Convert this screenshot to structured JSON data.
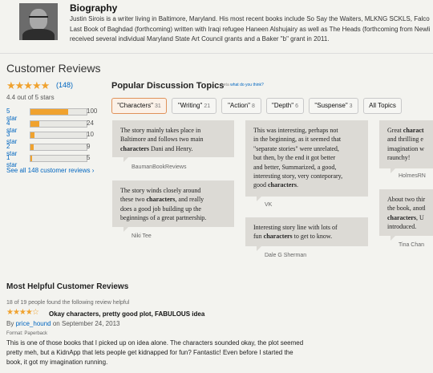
{
  "biography": {
    "title": "Biography",
    "lines": [
      "Justin Sirois is a writer living in Baltimore, Maryland. His most recent books include So Say the Waiters, MLKNG SCKLS, Falco",
      "Last Book of Baghdad (forthcoming) written with Iraqi refugee Haneen Alshujairy as well as The Heads (forthcoming from Newli",
      "received several individual Maryland State Art Council grants and a Baker \"b\" grant in 2011."
    ]
  },
  "summary": {
    "title": "Customer Reviews",
    "stars": "★★★★★",
    "count": "(148)",
    "out_of": "4.4 out of 5 stars",
    "rating": 4.4,
    "histogram": [
      {
        "label": "5 star",
        "count": "100",
        "fraction": 0.676
      },
      {
        "label": "4 star",
        "count": "24",
        "fraction": 0.162
      },
      {
        "label": "3 star",
        "count": "10",
        "fraction": 0.068
      },
      {
        "label": "2 star",
        "count": "9",
        "fraction": 0.061
      },
      {
        "label": "1 star",
        "count": "5",
        "fraction": 0.034
      }
    ],
    "see_all": "See all 148 customer reviews ›"
  },
  "topics": {
    "title": "Popular Discussion Topics",
    "beta": "beta",
    "beta_link": "what do you think?",
    "buttons": [
      {
        "label": "\"Characters\"",
        "count": "31"
      },
      {
        "label": "\"Writing\"",
        "count": "21"
      },
      {
        "label": "\"Action\"",
        "count": "8"
      },
      {
        "label": "\"Depth\"",
        "count": "6"
      },
      {
        "label": "\"Suspense\"",
        "count": "3"
      },
      {
        "label": "All Topics",
        "count": ""
      }
    ]
  },
  "snippets": [
    {
      "author": "BaumanBookReviews",
      "lines": [
        "The story mainly takes place in",
        "Baltimore and follows two main",
        "[characters] Dani and Henry."
      ]
    },
    {
      "author": "Niki Tee",
      "lines": [
        "The story winds closely around",
        "these two [characters], and really",
        "does a good job building up the",
        "beginnings of a great partnership."
      ]
    },
    {
      "author": "VK",
      "lines": [
        "This was interesting, perhaps not",
        "in the beginning, as it seemed that",
        "\"separate stories\" were unrelated,",
        "but then, by the end it got better",
        "and better, Summarized, a good,",
        "interesting story, very conteporary,",
        "good [characters]."
      ]
    },
    {
      "author": "Dale G Sherman",
      "lines": [
        "Interesting story line with lots of",
        "fun [characters] to get to know."
      ]
    },
    {
      "author": "HolmesRN",
      "lines": [
        "Great [charact]",
        "and thrilling e",
        "imagination w",
        "raunchy!"
      ]
    },
    {
      "author": "Tina Chan",
      "lines": [
        "About two thir",
        "the book, anotl",
        "[characters], U",
        "introduced."
      ]
    }
  ],
  "most_helpful": {
    "title": "Most Helpful Customer Reviews",
    "found_helpful": "18 of 19 people found the following review helpful",
    "stars": "★★★★☆",
    "review_title": "Okay characters, pretty good plot, FABULOUS idea",
    "by_prefix": "By",
    "reviewer": "price_hound",
    "date": "on September 24, 2013",
    "format": "Format: Paperback",
    "body": [
      "This is one of those books that I picked up on idea alone. The characters sounded okay, the plot seemed",
      "pretty meh, but a KidnApp that lets people get kidnapped for fun? Fantastic! Even before I started the",
      "book, it got my imagination running."
    ]
  },
  "colors": {
    "accent_star": "#f0a22e",
    "link": "#0066c0",
    "card_bg": "#dcdad5",
    "active_topic_border": "#e0925a"
  }
}
